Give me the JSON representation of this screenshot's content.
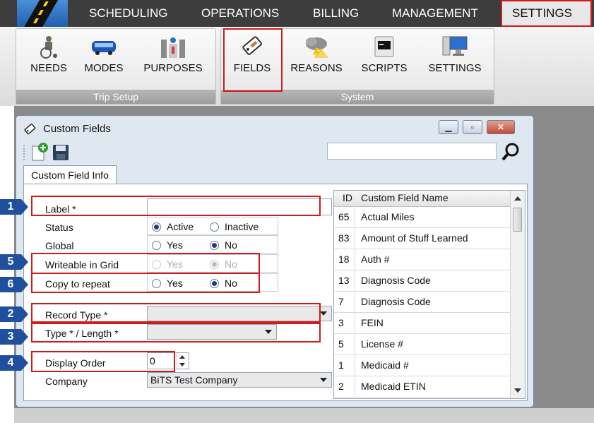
{
  "topbar": {
    "menu": [
      "SCHEDULING",
      "OPERATIONS",
      "BILLING",
      "MANAGEMENT",
      "SETTINGS"
    ],
    "selected": "SETTINGS"
  },
  "ribbon": {
    "trip_setup": {
      "caption": "Trip Setup",
      "buttons": [
        "NEEDS",
        "MODES",
        "PURPOSES"
      ]
    },
    "system": {
      "caption": "System",
      "buttons": [
        "FIELDS",
        "REASONS",
        "SCRIPTS",
        "SETTINGS"
      ]
    }
  },
  "window": {
    "title": "Custom Fields",
    "tab": "Custom Field Info",
    "search_value": ""
  },
  "form": {
    "label": {
      "text": "Label *",
      "value": ""
    },
    "status": {
      "text": "Status",
      "opt1": "Active",
      "opt2": "Inactive",
      "selected": "Active"
    },
    "global": {
      "text": "Global",
      "opt1": "Yes",
      "opt2": "No",
      "selected": "No"
    },
    "writeable": {
      "text": "Writeable in Grid",
      "opt1": "Yes",
      "opt2": "No",
      "selected": "No",
      "disabled": true
    },
    "copy": {
      "text": "Copy to repeat",
      "opt1": "Yes",
      "opt2": "No",
      "selected": "No"
    },
    "record_type": {
      "text": "Record Type *",
      "value": ""
    },
    "type_length": {
      "text": "Type * / Length *",
      "value": ""
    },
    "display_order": {
      "text": "Display Order",
      "value": "0"
    },
    "company": {
      "text": "Company",
      "value": "BiTS Test Company"
    }
  },
  "callouts": [
    "1",
    "5",
    "6",
    "2",
    "3",
    "4"
  ],
  "grid": {
    "columns": [
      "ID",
      "Custom Field Name"
    ],
    "rows": [
      {
        "id": "65",
        "name": "Actual Miles"
      },
      {
        "id": "83",
        "name": "Amount of Stuff Learned"
      },
      {
        "id": "18",
        "name": "Auth #"
      },
      {
        "id": "13",
        "name": "Diagnosis Code"
      },
      {
        "id": "7",
        "name": "Diagnosis Code"
      },
      {
        "id": "3",
        "name": "FEIN"
      },
      {
        "id": "5",
        "name": "License #"
      },
      {
        "id": "1",
        "name": "Medicaid #"
      },
      {
        "id": "2",
        "name": "Medicaid ETIN"
      }
    ]
  },
  "colors": {
    "accent_red": "#d21a1a",
    "callout_blue": "#1f4f9d",
    "menu_bg": "#3d3d3d"
  }
}
